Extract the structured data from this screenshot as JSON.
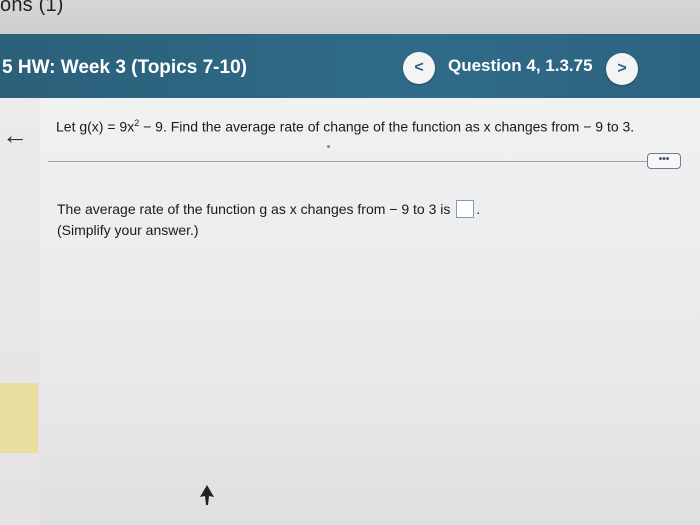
{
  "top": {
    "partial_text": "ons (1)"
  },
  "header": {
    "hw_title": "5 HW: Week 3 (Topics 7-10)",
    "prev_glyph": "<",
    "next_glyph": ">",
    "question_label": "Question 4, 1.3.75"
  },
  "sidebar": {
    "back_glyph": "←"
  },
  "question": {
    "prefix": "Let g(x) = 9x",
    "exponent": "2",
    "suffix": " − 9. Find the average rate of change of the function as x changes from − 9 to 3."
  },
  "more_button": {
    "label": "•••"
  },
  "answer": {
    "text_before": "The average rate of the function g as x changes from − 9 to 3 is",
    "text_after": ".",
    "input_value": "",
    "hint": "(Simplify your answer.)"
  },
  "colors": {
    "header": "#2f6b88",
    "accent_box": "#7a9cc4"
  },
  "icons": {
    "back": "arrow-left-icon",
    "prev": "chevron-left-icon",
    "next": "chevron-right-icon"
  }
}
